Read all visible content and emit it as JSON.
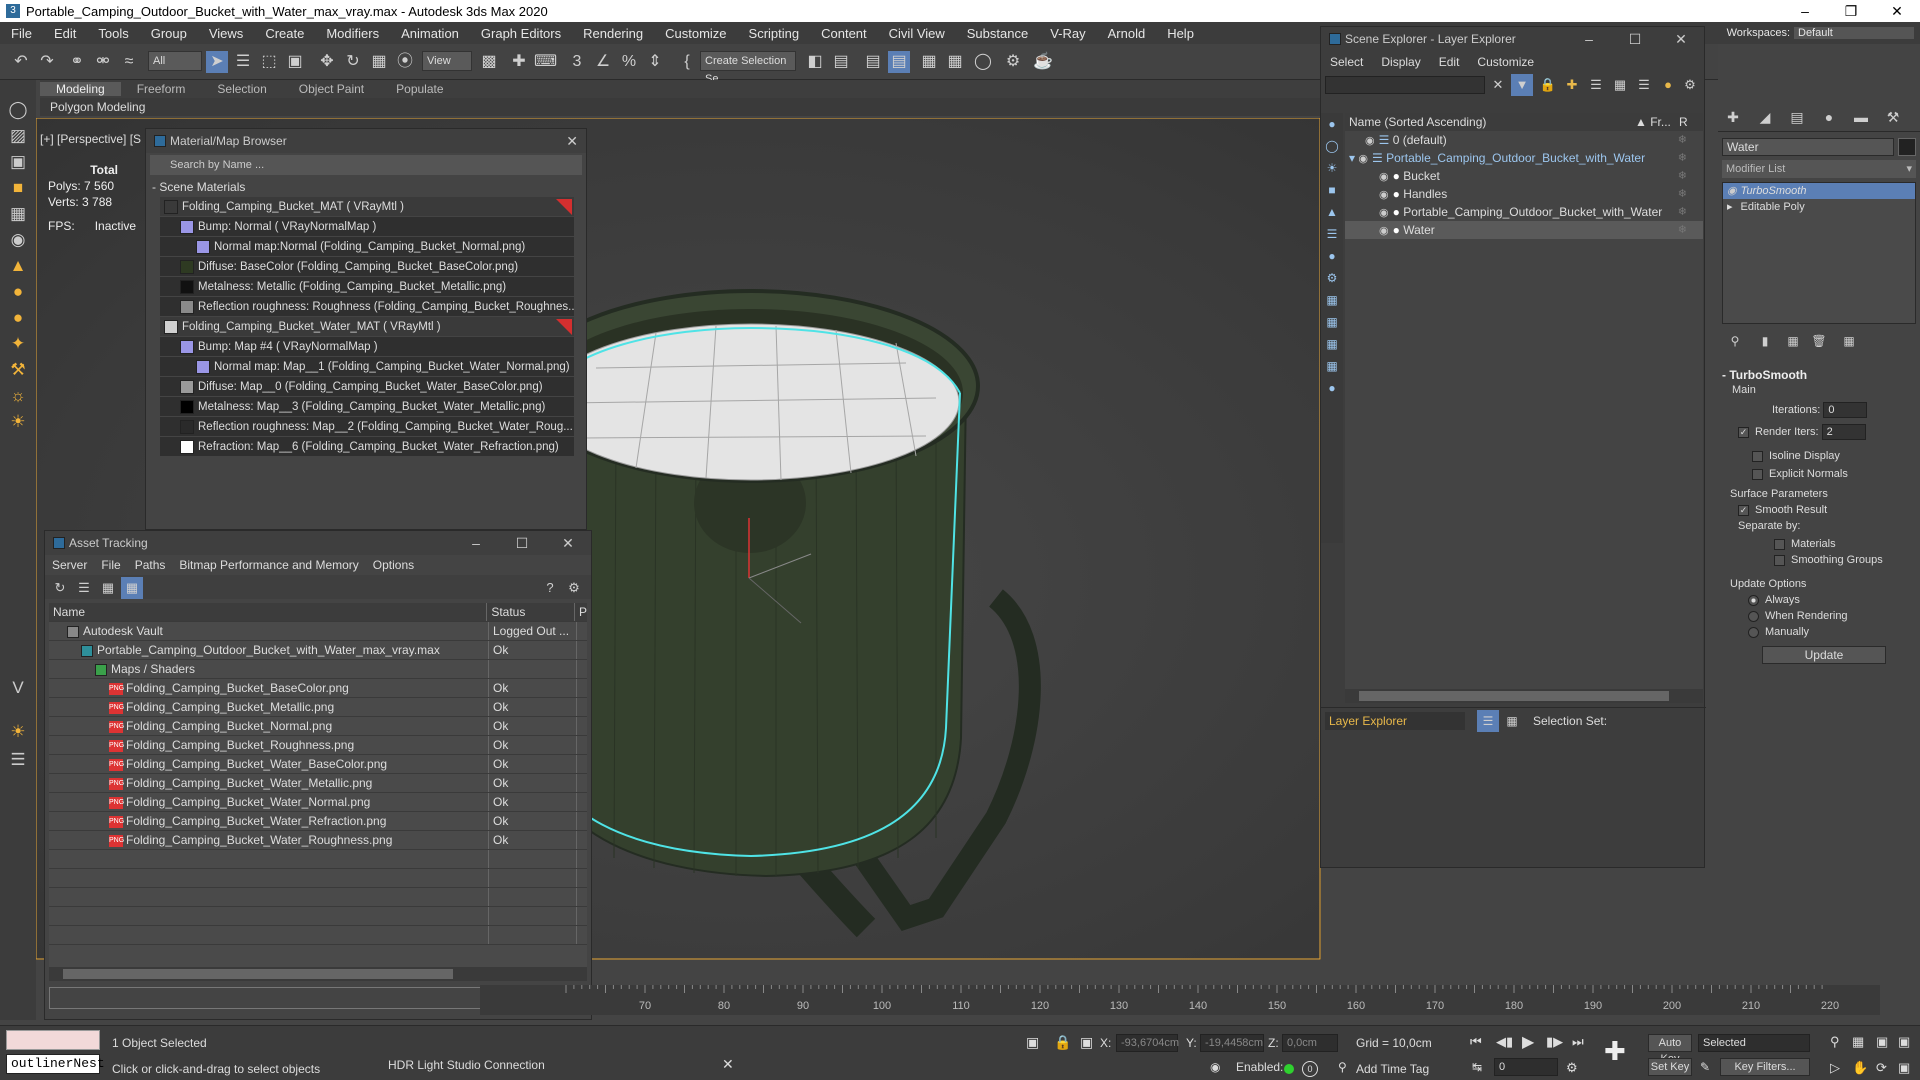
{
  "app": {
    "title": "Portable_Camping_Outdoor_Bucket_with_Water_max_vray.max - Autodesk 3ds Max 2020",
    "menus": [
      "File",
      "Edit",
      "Tools",
      "Group",
      "Views",
      "Create",
      "Modifiers",
      "Animation",
      "Graph Editors",
      "Rendering",
      "Customize",
      "Scripting",
      "Content",
      "Civil View",
      "Substance",
      "V-Ray",
      "Arnold",
      "Help"
    ],
    "workspaces_label": "Workspaces:",
    "workspace_value": "Default"
  },
  "toolbar": {
    "selection_filter": "All",
    "ref_coord": "View",
    "create_selection_set": "Create Selection Se"
  },
  "ribbon": {
    "tabs": [
      "Modeling",
      "Freeform",
      "Selection",
      "Object Paint",
      "Populate"
    ],
    "sub": "Polygon Modeling"
  },
  "viewport": {
    "label": "[+] [Perspective] [S",
    "stats": {
      "total_label": "Total",
      "polys_label": "Polys:",
      "polys_value": "7 560",
      "verts_label": "Verts:",
      "verts_value": "3 788",
      "fps_label": "FPS:",
      "fps_value": "Inactive"
    }
  },
  "material_browser": {
    "title": "Material/Map Browser",
    "search_placeholder": "Search by Name ...",
    "group": "Scene Materials",
    "items": [
      {
        "text": "Folding_Camping_Bucket_MAT  ( VRayMtl )",
        "level": 0,
        "swatch": "#3a3a3a"
      },
      {
        "text": "Bump: Normal  ( VRayNormalMap )",
        "level": 1,
        "swatch": "#9a96e6"
      },
      {
        "text": "Normal map:Normal (Folding_Camping_Bucket_Normal.png)",
        "level": 2,
        "swatch": "#9a96e6"
      },
      {
        "text": "Diffuse: BaseColor (Folding_Camping_Bucket_BaseColor.png)",
        "level": 1,
        "swatch": "#2e3a22"
      },
      {
        "text": "Metalness: Metallic (Folding_Camping_Bucket_Metallic.png)",
        "level": 1,
        "swatch": "#111111"
      },
      {
        "text": "Reflection roughness: Roughness (Folding_Camping_Bucket_Roughnes...",
        "level": 1,
        "swatch": "#8a8a8a"
      },
      {
        "text": "Folding_Camping_Bucket_Water_MAT  ( VRayMtl )",
        "level": 0,
        "swatch": "#d0d0d0"
      },
      {
        "text": "Bump: Map #4  ( VRayNormalMap )",
        "level": 1,
        "swatch": "#9a96e6"
      },
      {
        "text": "Normal map: Map__1 (Folding_Camping_Bucket_Water_Normal.png)",
        "level": 2,
        "swatch": "#9a96e6"
      },
      {
        "text": "Diffuse: Map__0 (Folding_Camping_Bucket_Water_BaseColor.png)",
        "level": 1,
        "swatch": "#9a9a9a"
      },
      {
        "text": "Metalness: Map__3 (Folding_Camping_Bucket_Water_Metallic.png)",
        "level": 1,
        "swatch": "#000000"
      },
      {
        "text": "Reflection roughness: Map__2 (Folding_Camping_Bucket_Water_Roug...",
        "level": 1,
        "swatch": "#2a2a2a"
      },
      {
        "text": "Refraction: Map__6 (Folding_Camping_Bucket_Water_Refraction.png)",
        "level": 1,
        "swatch": "#ffffff"
      }
    ]
  },
  "asset_tracking": {
    "title": "Asset Tracking",
    "menus": [
      "Server",
      "File",
      "Paths",
      "Bitmap Performance and Memory",
      "Options"
    ],
    "col_name": "Name",
    "col_status": "Status",
    "col_p": "P",
    "rows": [
      {
        "name": "Autodesk Vault",
        "status": "Logged Out ...",
        "level": 0,
        "icon": "vault"
      },
      {
        "name": "Portable_Camping_Outdoor_Bucket_with_Water_max_vray.max",
        "status": "Ok",
        "level": 1,
        "icon": "max"
      },
      {
        "name": "Maps / Shaders",
        "status": "",
        "level": 2,
        "icon": "maps"
      },
      {
        "name": "Folding_Camping_Bucket_BaseColor.png",
        "status": "Ok",
        "level": 3,
        "icon": "png"
      },
      {
        "name": "Folding_Camping_Bucket_Metallic.png",
        "status": "Ok",
        "level": 3,
        "icon": "png"
      },
      {
        "name": "Folding_Camping_Bucket_Normal.png",
        "status": "Ok",
        "level": 3,
        "icon": "png"
      },
      {
        "name": "Folding_Camping_Bucket_Roughness.png",
        "status": "Ok",
        "level": 3,
        "icon": "png"
      },
      {
        "name": "Folding_Camping_Bucket_Water_BaseColor.png",
        "status": "Ok",
        "level": 3,
        "icon": "png"
      },
      {
        "name": "Folding_Camping_Bucket_Water_Metallic.png",
        "status": "Ok",
        "level": 3,
        "icon": "png"
      },
      {
        "name": "Folding_Camping_Bucket_Water_Normal.png",
        "status": "Ok",
        "level": 3,
        "icon": "png"
      },
      {
        "name": "Folding_Camping_Bucket_Water_Refraction.png",
        "status": "Ok",
        "level": 3,
        "icon": "png"
      },
      {
        "name": "Folding_Camping_Bucket_Water_Roughness.png",
        "status": "Ok",
        "level": 3,
        "icon": "png"
      }
    ]
  },
  "scene_explorer": {
    "title": "Scene Explorer - Layer Explorer",
    "menus": [
      "Select",
      "Display",
      "Edit",
      "Customize"
    ],
    "col_name": "Name (Sorted Ascending)",
    "col_fr": "▲ Fr...",
    "col_r": "R",
    "items": [
      {
        "name": "0 (default)",
        "level": 0,
        "selected": false
      },
      {
        "name": "Portable_Camping_Outdoor_Bucket_with_Water",
        "level": 0,
        "selected": true
      },
      {
        "name": "Bucket",
        "level": 1,
        "selected": false
      },
      {
        "name": "Handles",
        "level": 1,
        "selected": false
      },
      {
        "name": "Portable_Camping_Outdoor_Bucket_with_Water",
        "level": 1,
        "selected": false
      },
      {
        "name": "Water",
        "level": 1,
        "selected": true
      }
    ],
    "footer_label": "Layer Explorer",
    "selection_set_label": "Selection Set:"
  },
  "command_panel": {
    "object_name": "Water",
    "modifier_list": "Modifier List",
    "stack": [
      "TurboSmooth",
      "Editable Poly"
    ],
    "rollout_title": "TurboSmooth",
    "main_label": "Main",
    "iterations_label": "Iterations:",
    "iterations_value": "0",
    "render_iters_label": "Render Iters:",
    "render_iters_value": "2",
    "isoline_label": "Isoline Display",
    "explicit_normals_label": "Explicit Normals",
    "surface_params_label": "Surface Parameters",
    "smooth_result_label": "Smooth Result",
    "separate_by_label": "Separate by:",
    "materials_label": "Materials",
    "smoothing_groups_label": "Smoothing Groups",
    "update_options_label": "Update Options",
    "always_label": "Always",
    "when_rendering_label": "When Rendering",
    "manually_label": "Manually",
    "update_button": "Update"
  },
  "timeline": {
    "ticks": [
      "70",
      "80",
      "90",
      "100",
      "110",
      "120",
      "130",
      "140",
      "150",
      "160",
      "170",
      "180",
      "190",
      "200",
      "210",
      "220"
    ]
  },
  "status": {
    "script_field": "outlinerNest",
    "objects_selected": "1 Object Selected",
    "prompt": "Click or click-and-drag to select objects",
    "hdr": "HDR Light Studio Connection",
    "x_label": "X:",
    "x_value": "-93,6704cm",
    "y_label": "Y:",
    "y_value": "-19,4458cm",
    "z_label": "Z:",
    "z_value": "0,0cm",
    "grid": "Grid = 10,0cm",
    "enabled_label": "Enabled:",
    "add_time_tag": "Add Time Tag",
    "auto_key": "Auto Key",
    "set_key": "Set Key",
    "selected_dropdown": "Selected",
    "frame_value": "0",
    "key_filters": "Key Filters..."
  }
}
